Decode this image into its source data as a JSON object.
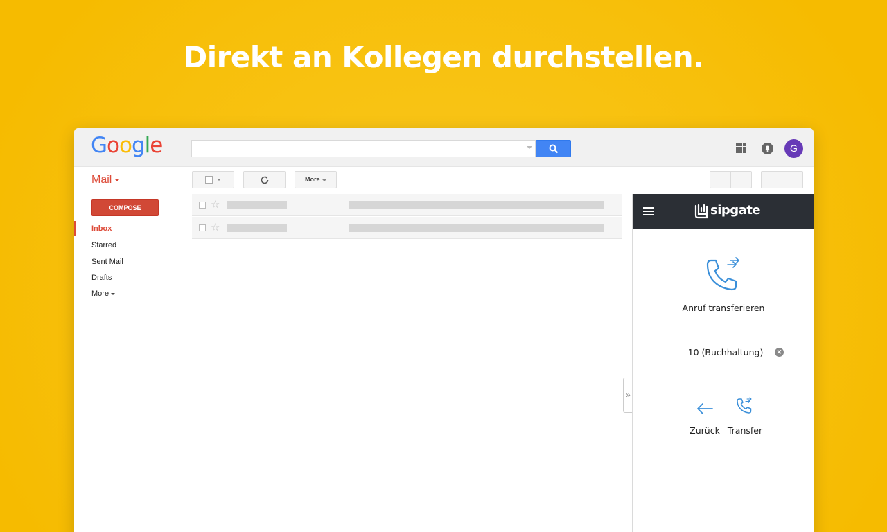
{
  "headline": "Direkt an Kollegen durchstellen.",
  "google_logo": {
    "letters": [
      "G",
      "o",
      "o",
      "g",
      "l",
      "e"
    ],
    "colors": [
      "#4285f4",
      "#ea4335",
      "#fbbc05",
      "#4285f4",
      "#34a853",
      "#ea4335"
    ]
  },
  "search": {
    "value": "",
    "button_icon": "search-icon"
  },
  "header_icons": {
    "apps": "apps-grid-icon",
    "notifications": "bell-icon",
    "avatar_letter": "G",
    "avatar_color": "#673ab7"
  },
  "mail": {
    "label": "Mail"
  },
  "toolbar": {
    "more_label": "More"
  },
  "sidebar": {
    "compose": "COMPOSE",
    "items": [
      {
        "label": "Inbox",
        "active": true
      },
      {
        "label": "Starred"
      },
      {
        "label": "Sent Mail"
      },
      {
        "label": "Drafts"
      },
      {
        "label": "More"
      }
    ]
  },
  "sipgate": {
    "brand": "sipgate",
    "header_bg": "#2b2f35",
    "accent": "#3a8fd9",
    "transfer_title": "Anruf transferieren",
    "target_value": "10 (Buchhaltung)",
    "back_label": "Zurück",
    "transfer_label": "Transfer"
  },
  "colors": {
    "background": "#f7bf0a",
    "compose_red": "#d14836",
    "mail_red": "#dd4b39",
    "search_blue": "#4285f4"
  }
}
